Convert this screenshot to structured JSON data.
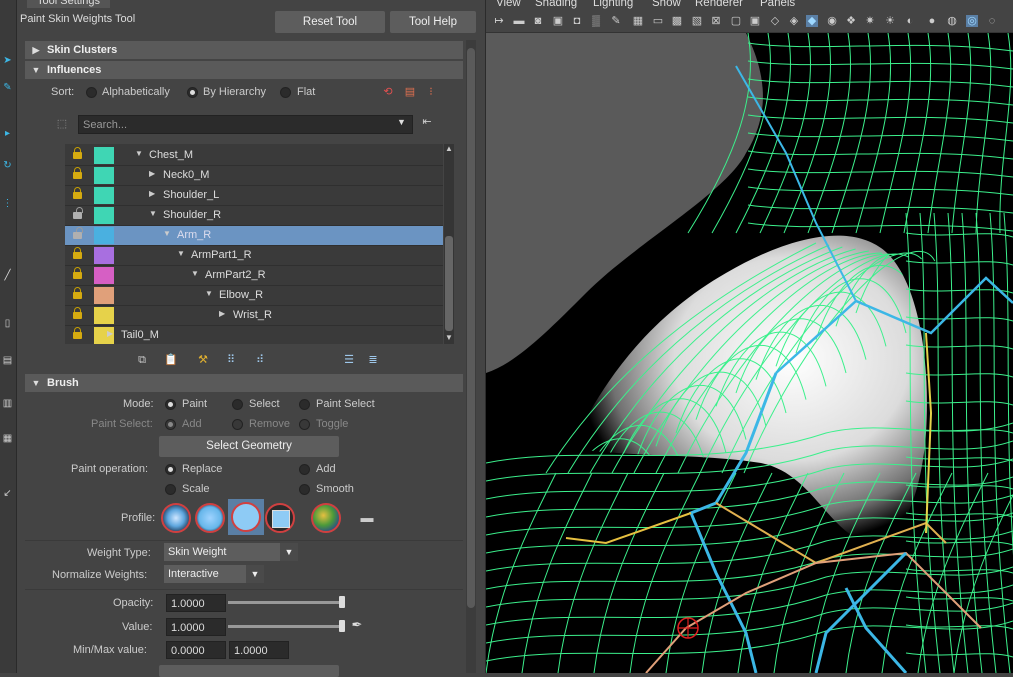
{
  "panel": {
    "tab_title": "Tool Settings",
    "tool_title": "Paint Skin Weights Tool",
    "reset_label": "Reset Tool",
    "help_label": "Tool Help"
  },
  "skin_clusters": {
    "title": "Skin Clusters"
  },
  "influences": {
    "title": "Influences",
    "sort_label": "Sort:",
    "sort_options": [
      "Alphabetically",
      "By Hierarchy",
      "Flat"
    ],
    "sort_selected": "By Hierarchy",
    "search_placeholder": "Search...",
    "rows": [
      {
        "name": "Chest_M",
        "color": "#3fd6b4",
        "locked": true,
        "expanded": true
      },
      {
        "name": "Neck0_M",
        "color": "#3fd6b4",
        "locked": true,
        "expanded": false
      },
      {
        "name": "Shoulder_L",
        "color": "#3fd6b4",
        "locked": true,
        "expanded": false
      },
      {
        "name": "Shoulder_R",
        "color": "#3fd6b4",
        "locked": false,
        "expanded": true
      },
      {
        "name": "Arm_R",
        "color": "#4ab0e0",
        "locked": false,
        "expanded": true,
        "selected": true
      },
      {
        "name": "ArmPart1_R",
        "color": "#a86fe0",
        "locked": true,
        "expanded": true
      },
      {
        "name": "ArmPart2_R",
        "color": "#d65fc4",
        "locked": true,
        "expanded": true
      },
      {
        "name": "Elbow_R",
        "color": "#e0a07a",
        "locked": true,
        "expanded": true
      },
      {
        "name": "Wrist_R",
        "color": "#e6d24a",
        "locked": true,
        "expanded": false
      },
      {
        "name": "Tail0_M",
        "color": "#e6d24a",
        "locked": true,
        "expanded": false
      }
    ]
  },
  "brush": {
    "title": "Brush",
    "mode_label": "Mode:",
    "mode_options": [
      "Paint",
      "Select",
      "Paint Select"
    ],
    "mode_selected": "Paint",
    "paint_select_label": "Paint Select:",
    "paint_select_options": [
      "Add",
      "Remove",
      "Toggle"
    ],
    "select_geometry_label": "Select Geometry",
    "paint_op_label": "Paint operation:",
    "paint_op_options": [
      "Replace",
      "Add",
      "Scale",
      "Smooth"
    ],
    "paint_op_selected": "Replace",
    "profile_label": "Profile:",
    "weight_type_label": "Weight Type:",
    "weight_type_value": "Skin Weight",
    "normalize_label": "Normalize Weights:",
    "normalize_value": "Interactive",
    "opacity_label": "Opacity:",
    "opacity_value": "1.0000",
    "opacity_level": 1.0,
    "value_label": "Value:",
    "value_value": "1.0000",
    "value_level": 1.0,
    "minmax_label": "Min/Max value:",
    "min_value": "0.0000",
    "max_value": "1.0000"
  },
  "viewport": {
    "menus": [
      "View",
      "Shading",
      "Lighting",
      "Show",
      "Renderer",
      "Panels"
    ]
  },
  "colors": {
    "accent": "#6b94c2",
    "wireframe": "#3cf08c",
    "joint": "#3cb7e6"
  }
}
